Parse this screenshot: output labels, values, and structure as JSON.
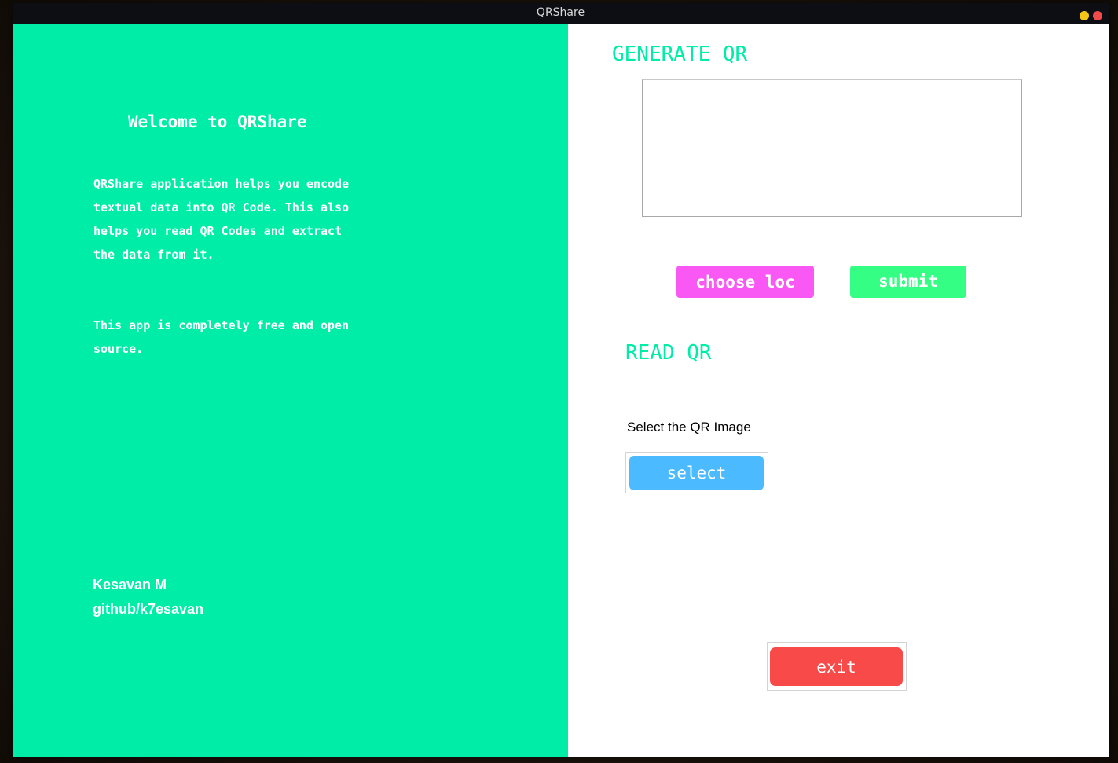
{
  "window": {
    "title": "QRShare",
    "controls": {
      "minimize_color": "#f5c518",
      "close_color": "#f04a4a"
    }
  },
  "colors": {
    "accent": "#00eda8",
    "choose_loc": "#fa58f4",
    "submit": "#34ff84",
    "select": "#4cbaff",
    "exit": "#f94a4a"
  },
  "left_panel": {
    "welcome": "Welcome to QRShare",
    "description_1": "QRShare application helps you encode textual data into QR Code. This also helps you read QR Codes and extract the data from it.",
    "description_2": "This app is completely free and open source.",
    "author_name": "Kesavan M",
    "author_github": "github/k7esavan"
  },
  "generate": {
    "title": "GENERATE QR",
    "text_value": "",
    "choose_label": "choose loc",
    "submit_label": "submit"
  },
  "read": {
    "title": "READ QR",
    "select_prompt": "Select the QR Image",
    "select_label": "select"
  },
  "exit_label": "exit"
}
